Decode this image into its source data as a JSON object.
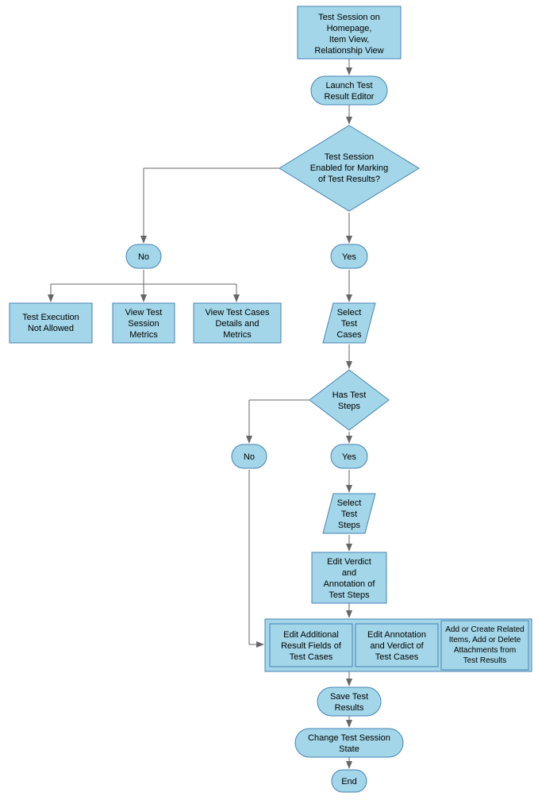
{
  "colors": {
    "fill": "#a3d6e8",
    "stroke": "#4682b4",
    "arrow": "#666666"
  },
  "nodes": {
    "start": {
      "line1": "Test Session on",
      "line2": "Homepage,",
      "line3": "Item View,",
      "line4": "Relationship View"
    },
    "launch": {
      "line1": "Launch Test",
      "line2": "Result Editor"
    },
    "decision1": {
      "line1": "Test Session",
      "line2": "Enabled for Marking",
      "line3": "of Test Results?"
    },
    "no1": "No",
    "yes1": "Yes",
    "noOption1": {
      "line1": "Test Execution",
      "line2": "Not Allowed"
    },
    "noOption2": {
      "line1": "View Test",
      "line2": "Session",
      "line3": "Metrics"
    },
    "noOption3": {
      "line1": "View Test Cases",
      "line2": "Details and",
      "line3": "Metrics"
    },
    "selectCases": {
      "line1": "Select",
      "line2": "Test",
      "line3": "Cases"
    },
    "decision2": {
      "line1": "Has Test",
      "line2": "Steps"
    },
    "no2": "No",
    "yes2": "Yes",
    "selectSteps": {
      "line1": "Select",
      "line2": "Test",
      "line3": "Steps"
    },
    "editVerdict": {
      "line1": "Edit Verdict",
      "line2": "and",
      "line3": "Annotation of",
      "line4": "Test Steps"
    },
    "subBox1": {
      "line1": "Edit Additional",
      "line2": "Result Fields of",
      "line3": "Test Cases"
    },
    "subBox2": {
      "line1": "Edit Annotation",
      "line2": "and Verdict of",
      "line3": "Test Cases"
    },
    "subBox3": {
      "line1": "Add or Create Related",
      "line2": "Items, Add or Delete",
      "line3": "Attachments from",
      "line4": "Test Results"
    },
    "saveResults": {
      "line1": "Save Test",
      "line2": "Results"
    },
    "changeState": {
      "line1": "Change Test Session",
      "line2": "State"
    },
    "end": "End"
  }
}
